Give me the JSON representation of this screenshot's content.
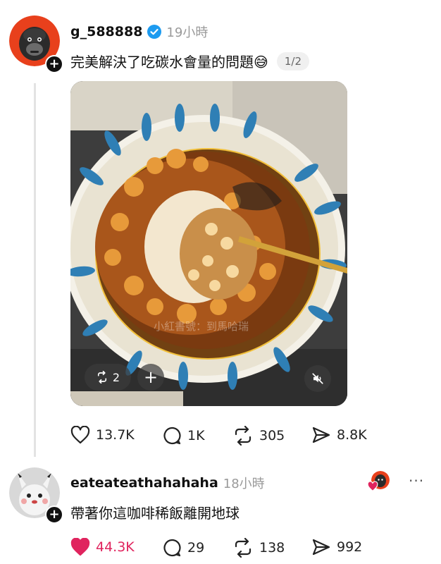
{
  "post": {
    "username": "g_588888",
    "time": "19小時",
    "text": "完美解決了吃碳水會量的問題",
    "emoji": "😅",
    "pager": "1/2",
    "media": {
      "repost_count": "2",
      "watermark": "小紅書號：到馬哈瑞"
    },
    "actions": {
      "likes": "13.7K",
      "comments": "1K",
      "reposts": "305",
      "shares": "8.8K"
    }
  },
  "reply": {
    "username": "eateateathahahaha",
    "time": "18小時",
    "text": "帶著你這咖啡稀飯離開地球",
    "more": "···",
    "actions": {
      "likes": "44.3K",
      "comments": "29",
      "reposts": "138",
      "shares": "992"
    }
  },
  "colors": {
    "verified": "#1d9bf0",
    "liked": "#e0245e"
  }
}
